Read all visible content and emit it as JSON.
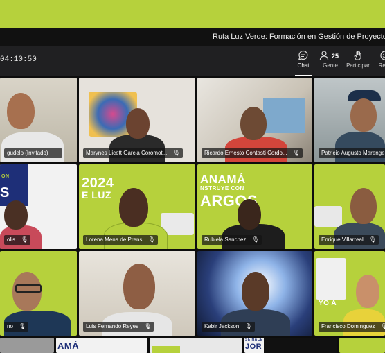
{
  "meeting": {
    "title": "Ruta Luz Verde: Formación en Gestión de Proyectos Ágile",
    "timer": "04:10:50"
  },
  "toolbar": {
    "chat": "Chat",
    "people": "Gente",
    "people_count": "25",
    "participate": "Participar",
    "react": "Reac"
  },
  "participants": [
    {
      "name": "gudelo (Invitado)",
      "more": "···"
    },
    {
      "name": "Marynes Licett Garcia Coromot...",
      "mic": "🎙"
    },
    {
      "name": "Ricardo Ernesto Contasti Cordo...",
      "mic": "🎙"
    },
    {
      "name": "Patricio Augusto Marenge"
    },
    {
      "name": "olis",
      "mic": "🎙"
    },
    {
      "name": "Lorena Mena de Prens",
      "mic": "🎙"
    },
    {
      "name": "Rubiela Sanchez",
      "mic": "🎙"
    },
    {
      "name": "Enrique Villarreal",
      "mic": "🎙"
    },
    {
      "name": "no",
      "mic": "🎙"
    },
    {
      "name": "Luis Fernando Reyes",
      "mic": "🎙"
    },
    {
      "name": "Kabir Jackson",
      "mic": "🎙"
    },
    {
      "name": "Francisco Dominguez",
      "mic": "🎙"
    }
  ],
  "backgrounds": {
    "b5": "S",
    "b5_small": "ON",
    "b6": "2024",
    "b6_sub": "E LUZ",
    "b7": "ANAMÁ",
    "b7_sub": "NSTRUYE CON",
    "b7_big": "ARGOS",
    "b12": "YO A",
    "bottom_a": "AMÁ",
    "bottom_b": "JOR",
    "bottom_b_small": "SE HACE"
  },
  "colors": {
    "brand_green": "#b6d13c",
    "titlebar": "#111111",
    "toolbar": "#202022"
  }
}
